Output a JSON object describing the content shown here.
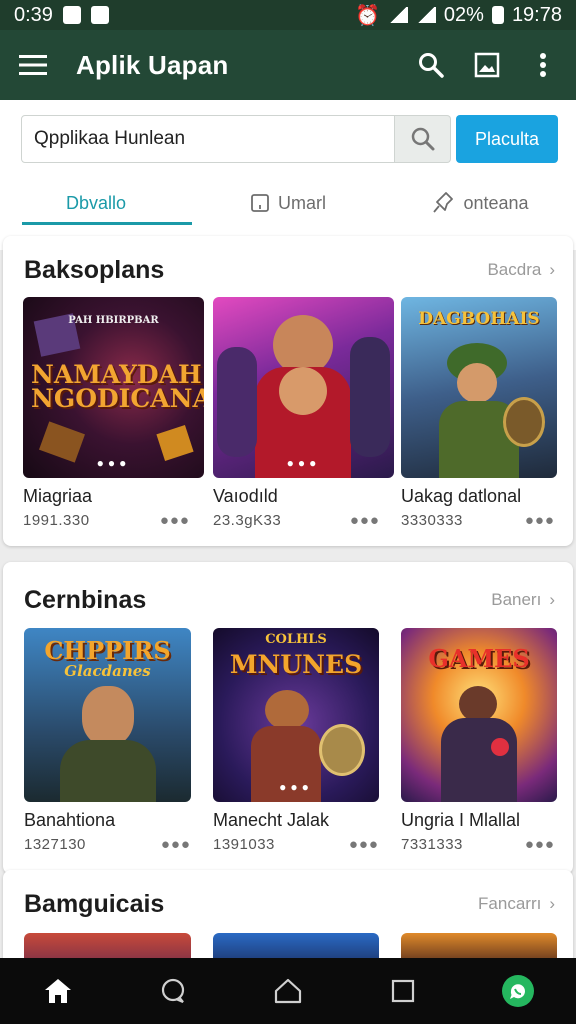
{
  "status_bar": {
    "time_left": "0:39",
    "battery": "02%",
    "time_right": "19:78"
  },
  "app_bar": {
    "title": "Aplik Uapan"
  },
  "search": {
    "value": "Qpplikaa Hunlean",
    "action_label": "Placulta"
  },
  "tabs": [
    {
      "label": "Dbvallo"
    },
    {
      "label": "Umarl"
    },
    {
      "label": "onteana"
    }
  ],
  "sections": [
    {
      "title": "Baksoplans",
      "see_all": "Bacdra",
      "items": [
        {
          "name": "Miagriaa",
          "meta": "1991.330",
          "art_top": "PAH HBIRPBAR",
          "art_main": "NAMAYDAH NGODICANA"
        },
        {
          "name": "Vaıodıld",
          "meta": "23.3gK33"
        },
        {
          "name": "Uakag datlonal",
          "meta": "3330333",
          "art_main": "DAGBOHAIS"
        }
      ]
    },
    {
      "title": "Cernbinas",
      "see_all": "Banerı",
      "items": [
        {
          "name": "Banahtiona",
          "meta": "1327130",
          "art_main": "CHPPIRS",
          "art_sub": "Glacdanes"
        },
        {
          "name": "Manecht Jalak",
          "meta": "1391033",
          "art_top": "COLHLS",
          "art_main": "MNUNES"
        },
        {
          "name": "Ungria I Mlallal",
          "meta": "7331333",
          "art_main": "GAMES"
        }
      ]
    },
    {
      "title": "Bamguicais",
      "see_all": "Fancarrı"
    }
  ],
  "colors": {
    "app_bar": "#234836",
    "accent": "#1b9aa8",
    "primary_button": "#1aa3e0",
    "chat_fab": "#25b75f"
  }
}
